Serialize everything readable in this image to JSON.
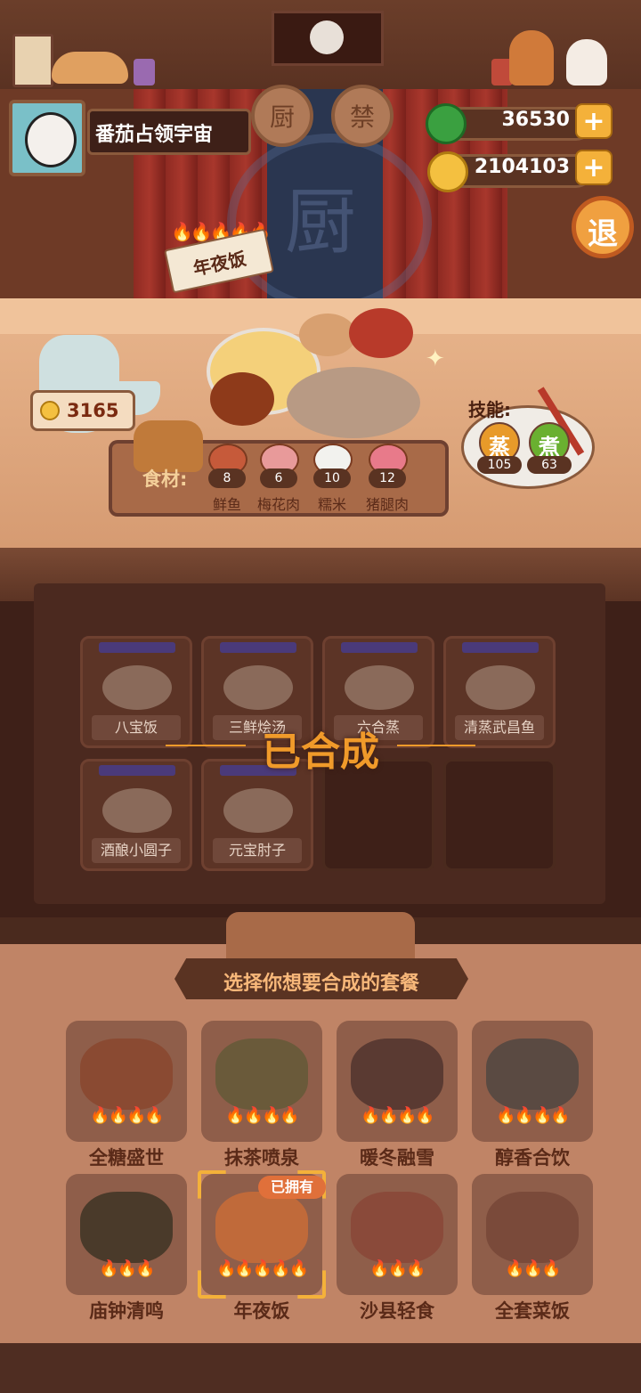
{
  "player": {
    "name": "番茄占领宇宙"
  },
  "currency": {
    "jade": "36530",
    "coins": "2104103",
    "plus_glyph": "+"
  },
  "exit_label": "退",
  "stage_signs": [
    "厨",
    "禁"
  ],
  "stage_emblem": "厨",
  "current_meal": {
    "tag": "年夜饭",
    "tag_flames": 5,
    "bottle_value": "3165"
  },
  "ingredients": {
    "label": "食材:",
    "items": [
      {
        "name": "鲜鱼",
        "count": "8",
        "color": "#c65a3a"
      },
      {
        "name": "梅花肉",
        "count": "6",
        "color": "#e89a9a"
      },
      {
        "name": "糯米",
        "count": "10",
        "color": "#f2f2ee"
      },
      {
        "name": "猪腿肉",
        "count": "12",
        "color": "#e87a8a"
      }
    ]
  },
  "skills": {
    "label": "技能:",
    "items": [
      {
        "name": "蒸",
        "value": "105",
        "color": "#e89a2a"
      },
      {
        "name": "煮",
        "value": "63",
        "color": "#6ab030"
      }
    ]
  },
  "synthesis": {
    "status": "已合成",
    "dishes": [
      {
        "name": "八宝饭"
      },
      {
        "name": "三鲜烩汤"
      },
      {
        "name": "六合蒸"
      },
      {
        "name": "清蒸武昌鱼"
      },
      {
        "name": "酒酿小圆子"
      },
      {
        "name": "元宝肘子"
      },
      {
        "name": ""
      },
      {
        "name": ""
      }
    ]
  },
  "selection": {
    "title": "选择你想要合成的套餐",
    "owned_badge": "已拥有",
    "meals": [
      {
        "name": "全糖盛世",
        "flames": 4
      },
      {
        "name": "抹茶喷泉",
        "flames": 4
      },
      {
        "name": "暖冬融雪",
        "flames": 4
      },
      {
        "name": "醇香合饮",
        "flames": 4
      },
      {
        "name": "庙钟清鸣",
        "flames": 3
      },
      {
        "name": "年夜饭",
        "flames": 5,
        "owned": true
      },
      {
        "name": "沙县轻食",
        "flames": 3
      },
      {
        "name": "全套菜饭",
        "flames": 3
      }
    ]
  },
  "colors": {
    "accent_gold": "#f4b13a",
    "status_orange": "#f09a2a",
    "flame": "#ff6a1a"
  }
}
